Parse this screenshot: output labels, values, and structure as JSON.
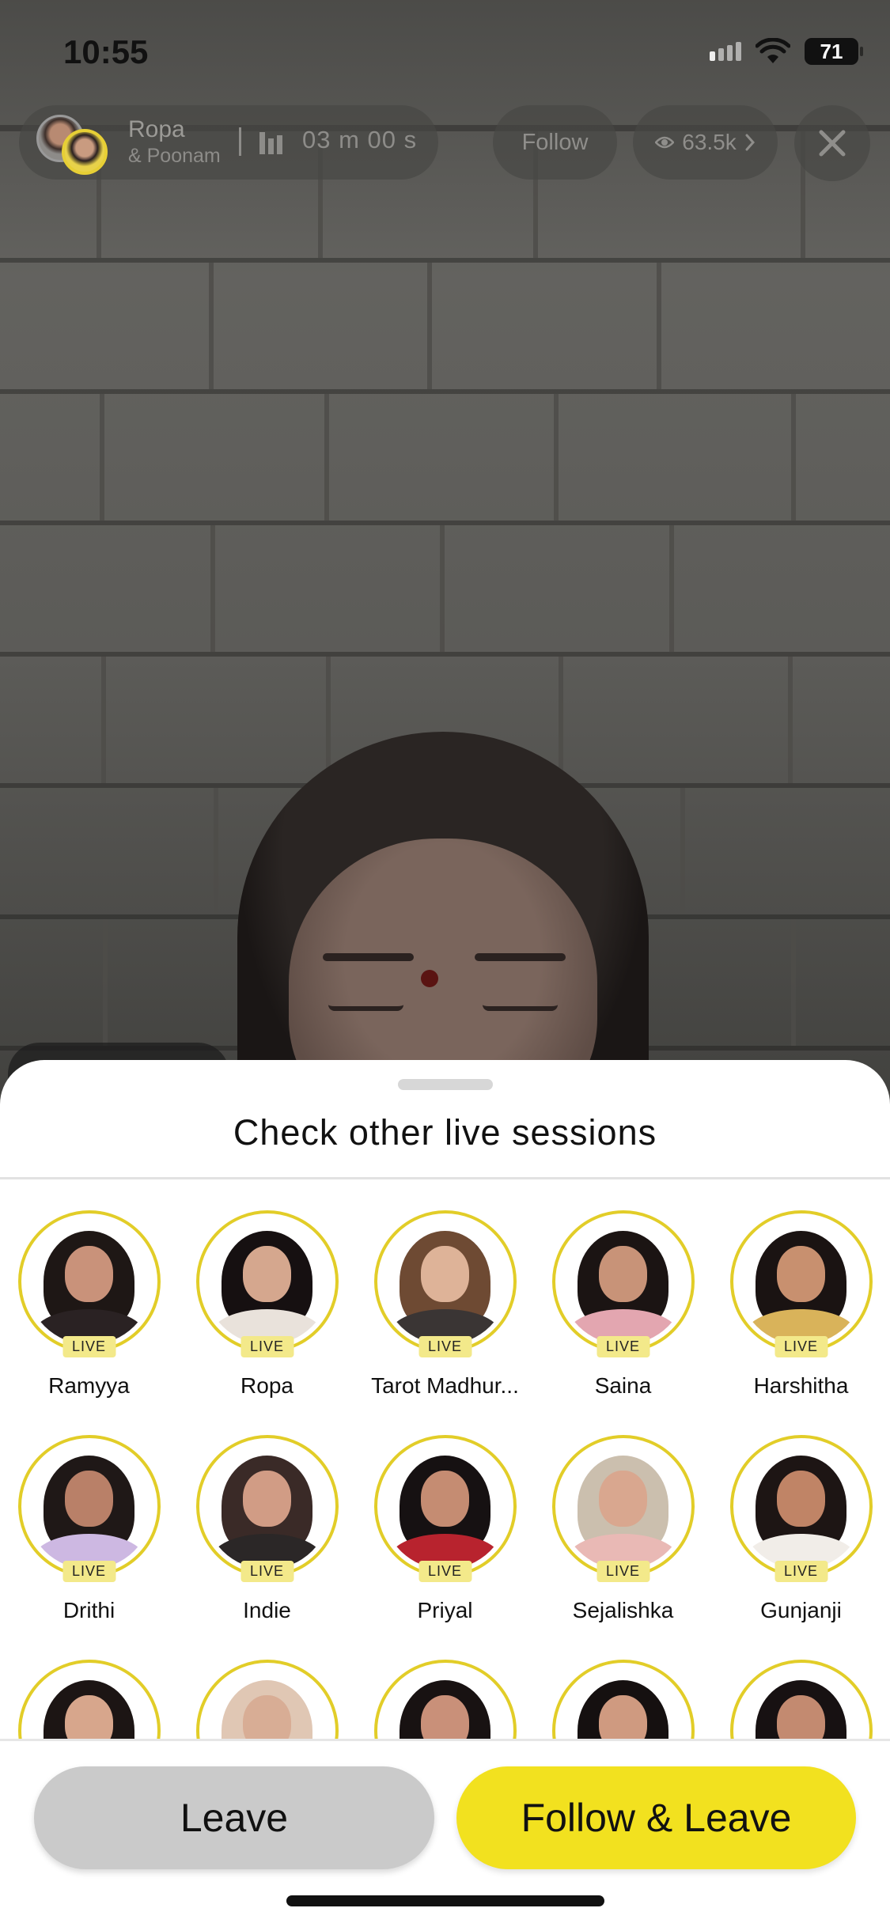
{
  "status_bar": {
    "time": "10:55",
    "battery": "71"
  },
  "live_header": {
    "host_name": "Ropa",
    "co_host": "& Poonam",
    "duration": "03 m 00 s",
    "follow_label": "Follow",
    "viewers": "63.5k"
  },
  "sheet": {
    "title": "Check other live sessions",
    "live_badge": "LIVE",
    "astrologers": [
      {
        "name": "Ramyya"
      },
      {
        "name": "Ropa"
      },
      {
        "name": "Tarot Madhur..."
      },
      {
        "name": "Saina"
      },
      {
        "name": "Harshitha"
      },
      {
        "name": "Drithi"
      },
      {
        "name": "Indie"
      },
      {
        "name": "Priyal"
      },
      {
        "name": "Sejalishka"
      },
      {
        "name": "Gunjanji"
      },
      {
        "name": ""
      },
      {
        "name": ""
      },
      {
        "name": ""
      },
      {
        "name": ""
      },
      {
        "name": ""
      }
    ],
    "leave_label": "Leave",
    "follow_leave_label": "Follow & Leave"
  },
  "colors": {
    "accent": "#f2e11f",
    "ring": "#e2cd28",
    "leave_bg": "#cacaca"
  }
}
